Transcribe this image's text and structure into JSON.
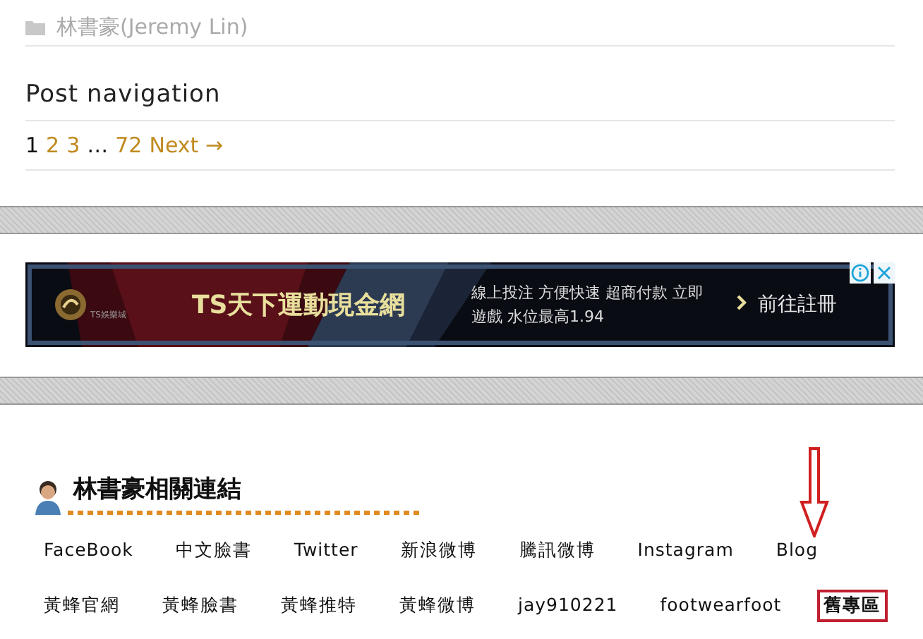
{
  "category": {
    "label": "林書豪(Jeremy Lin)"
  },
  "post_navigation": {
    "title": "Post navigation",
    "pages": [
      {
        "label": "1",
        "selected": true
      },
      {
        "label": "2",
        "selected": false
      },
      {
        "label": "3",
        "selected": false
      },
      {
        "label": "…",
        "kind": "gap"
      },
      {
        "label": "72",
        "selected": false
      },
      {
        "label": "Next →",
        "selected": false
      }
    ]
  },
  "ad": {
    "title": "TS天下運動現金網",
    "logo_caption": "TS娛樂城",
    "description": "線上投注 方便快速 超商付款 立即遊戲 水位最高1.94",
    "cta": "前往註冊"
  },
  "links_widget": {
    "title": "林書豪相關連結",
    "rows": [
      [
        {
          "label": "FaceBook",
          "highlighted": false
        },
        {
          "label": "中文臉書",
          "highlighted": false
        },
        {
          "label": "Twitter",
          "highlighted": false
        },
        {
          "label": "新浪微博",
          "highlighted": false
        },
        {
          "label": "騰訊微博",
          "highlighted": false
        },
        {
          "label": "Instagram",
          "highlighted": false
        },
        {
          "label": "Blog",
          "highlighted": false
        }
      ],
      [
        {
          "label": "黃蜂官網",
          "highlighted": false
        },
        {
          "label": "黃蜂臉書",
          "highlighted": false
        },
        {
          "label": "黃蜂推特",
          "highlighted": false
        },
        {
          "label": "黃蜂微博",
          "highlighted": false
        },
        {
          "label": "jay910221",
          "highlighted": false
        },
        {
          "label": "footwearfoot",
          "highlighted": false
        },
        {
          "label": "舊專區",
          "highlighted": true
        }
      ]
    ]
  }
}
